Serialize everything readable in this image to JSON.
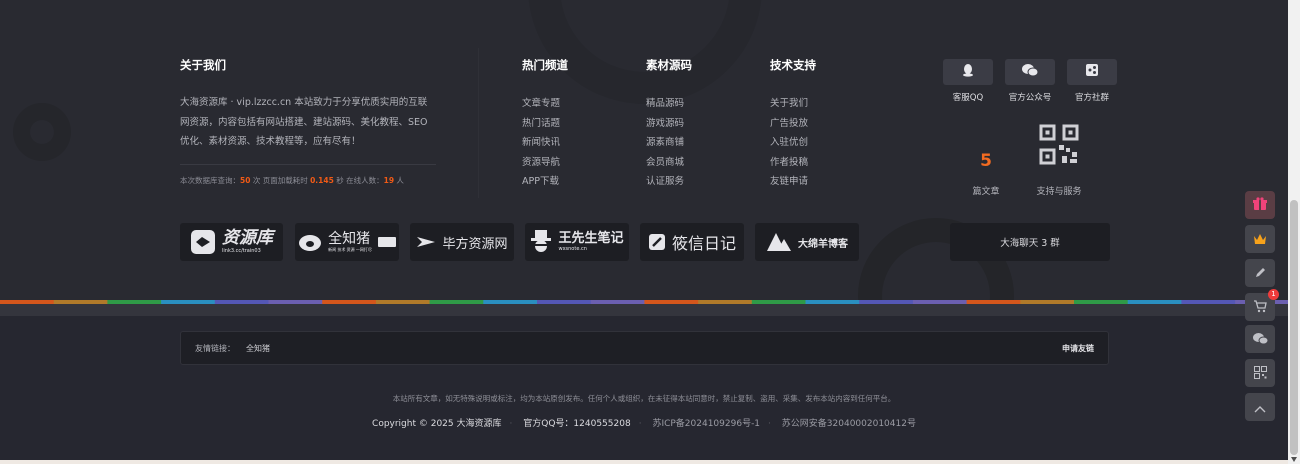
{
  "about": {
    "title": "关于我们",
    "description": "大海资源库 · vip.lzzcc.cn 本站致力于分享优质实用的互联网资源，内容包括有网站搭建、建站源码、美化教程、SEO优化、素材资源、技术教程等，应有尽有！",
    "stats": {
      "prefix": "本次数据库查询：",
      "queries": "50",
      "mid1": " 次 页面加载耗时 ",
      "load_time": "0.145",
      "mid2": " 秒 在线人数：",
      "online": "19",
      "suffix": " 人"
    }
  },
  "columns": [
    {
      "title": "热门频道",
      "items": [
        "文章专题",
        "热门话题",
        "新闻快讯",
        "资源导航",
        "APP下载"
      ]
    },
    {
      "title": "素材源码",
      "items": [
        "精品源码",
        "游戏源码",
        "源素商铺",
        "会员商城",
        "认证服务"
      ]
    },
    {
      "title": "技术支持",
      "items": [
        "关于我们",
        "广告投放",
        "入驻优创",
        "作者投稿",
        "友链申请"
      ]
    }
  ],
  "socials": [
    {
      "icon": "qq-penguin-icon",
      "label": "客服QQ"
    },
    {
      "icon": "wechat-icon",
      "label": "官方公众号"
    },
    {
      "icon": "share-icon",
      "label": "官方社群"
    }
  ],
  "article_count": {
    "value": "5",
    "label": "篇文章"
  },
  "support_label": "支持与服务",
  "partners": [
    {
      "text": "资源库",
      "sub": "link3.cc/train03",
      "icon": "fish-logo-icon"
    },
    {
      "text": "全知猪",
      "sub": "新闻 技术 资源 一网打尽",
      "icon": "pig-logo-icon"
    },
    {
      "text": "毕方资源网",
      "icon": "bird-logo-icon"
    },
    {
      "text": "王先生笔记",
      "sub": "wxsnote.cn",
      "icon": "gentleman-logo-icon"
    },
    {
      "text": "筱信日记",
      "icon": "book-logo-icon"
    },
    {
      "text": "大绵羊博客",
      "icon": "mountain-logo-icon"
    }
  ],
  "chat_group": "大海聊天 3 群",
  "friend_links": {
    "label": "友情链接：",
    "links": [
      "全知猪"
    ],
    "apply": "申请友链"
  },
  "notice": "本站所有文章，如无特殊说明或标注，均为本站原创发布。任何个人或组织，在未征得本站同意时，禁止复制、盗用、采集、发布本站内容到任何平台。",
  "copyright": {
    "text": "Copyright © 2025 大海资源库",
    "qq": "官方QQ号：1240555208",
    "icp": "苏ICP备2024109296号-1",
    "police": "苏公网安备32040002010412号"
  },
  "sidebar": [
    {
      "icon": "gift-icon",
      "color": "#e8457a"
    },
    {
      "icon": "crown-icon",
      "color": "#f7a21b"
    },
    {
      "icon": "pencil-icon",
      "color": "#bfc0c6"
    },
    {
      "icon": "cart-icon",
      "color": "#bfc0c6",
      "badge": "1"
    },
    {
      "icon": "wechat-icon",
      "color": "#bfc0c6"
    },
    {
      "icon": "qrcode-icon",
      "color": "#bfc0c6"
    },
    {
      "icon": "back-to-top-icon",
      "color": "#bfc0c6"
    }
  ],
  "colors": {
    "accent": "#f05a16",
    "background": "#292a31",
    "rainbow": [
      "#d4561c",
      "#b07a2a",
      "#2f9a47",
      "#2a8fc0",
      "#5457b5",
      "#6b5fb0"
    ]
  }
}
